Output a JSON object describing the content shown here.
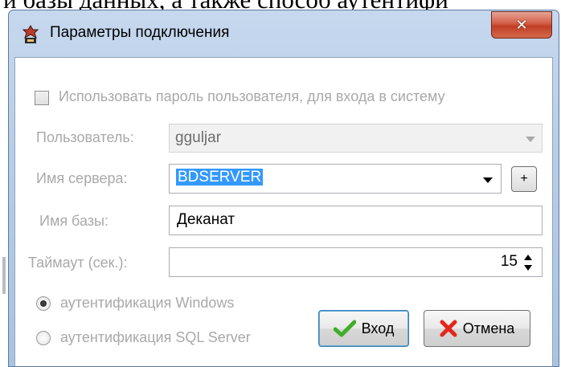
{
  "background": {
    "text": "и базы данных, а также способ аутентифи"
  },
  "window": {
    "title": "Параметры подключения",
    "close_glyph": "✕"
  },
  "form": {
    "use_password_label": "Использовать пароль пользователя, для  входа в систему",
    "use_password_checked": false,
    "user_label": "Пользователь:",
    "user_value": "gguljar",
    "server_label": "Имя сервера:",
    "server_value": "BDSERVER",
    "add_server_label": "+",
    "db_label": "Имя базы:",
    "db_value": "Деканат",
    "timeout_label": "Таймаут (сек.):",
    "timeout_value": "15"
  },
  "auth": {
    "windows_label": "аутентификация Windows",
    "sql_label": "аутентификация SQL Server",
    "selected": "windows"
  },
  "buttons": {
    "ok_label": "Вход",
    "cancel_label": "Отмена"
  },
  "colors": {
    "selection": "#3399ff",
    "ok_icon": "#3fae29",
    "cancel_icon": "#e3261b"
  }
}
